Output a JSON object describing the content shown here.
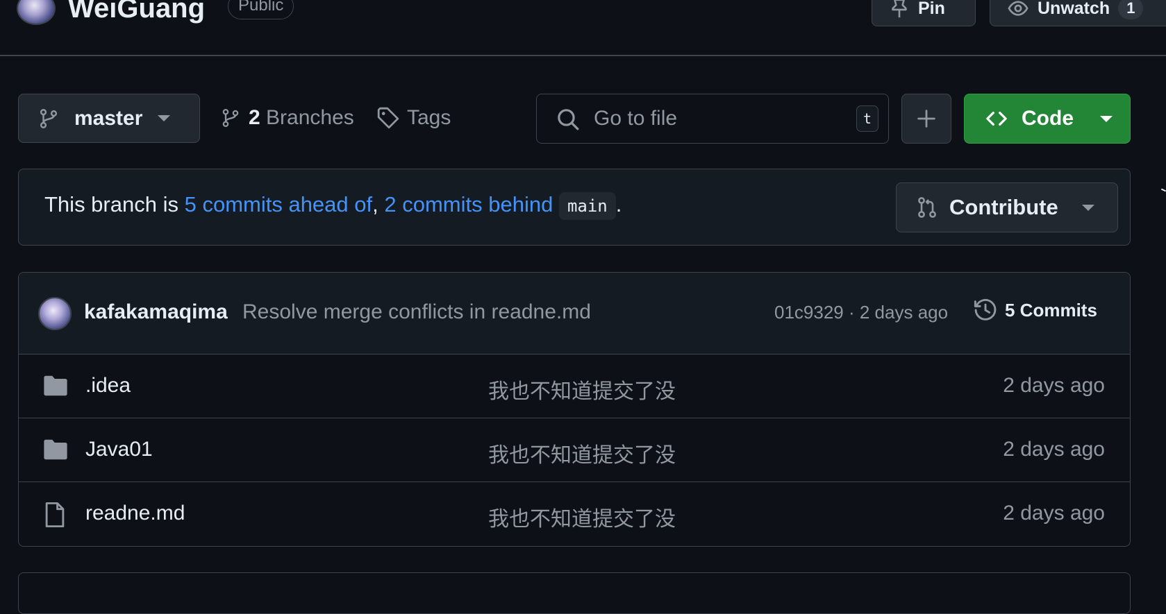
{
  "repo": {
    "name": "WeiGuang",
    "visibility": "Public"
  },
  "header_actions": {
    "pin_label": "Pin",
    "unwatch_label": "Unwatch",
    "watch_count": "1"
  },
  "toolbar": {
    "branch": "master",
    "branches_count": "2",
    "branches_label": "Branches",
    "tags_label": "Tags",
    "search_placeholder": "Go to file",
    "search_shortcut": "t",
    "code_label": "Code"
  },
  "compare": {
    "prefix": "This branch is",
    "ahead": "5 commits ahead of",
    "comma": ",",
    "behind": "2 commits behind",
    "base_branch": "main",
    "suffix": ".",
    "contribute_label": "Contribute"
  },
  "latest_commit": {
    "author": "kafakamaqima",
    "message": "Resolve merge conflicts in readne.md",
    "meta": "01c9329 · 2 days ago",
    "commits_label": "5 Commits"
  },
  "files": [
    {
      "icon": "folder-icon",
      "name": ".idea",
      "message": "我也不知道提交了没",
      "date": "2 days ago"
    },
    {
      "icon": "folder-icon",
      "name": "Java01",
      "message": "我也不知道提交了没",
      "date": "2 days ago"
    },
    {
      "icon": "file-icon",
      "name": "readne.md",
      "message": "我也不知道提交了没",
      "date": "2 days ago"
    }
  ],
  "colors": {
    "background": "#0d1117",
    "border": "#3d444d",
    "accent_green": "#238636",
    "link_blue": "#4493f8",
    "muted_text": "#9198a1"
  }
}
